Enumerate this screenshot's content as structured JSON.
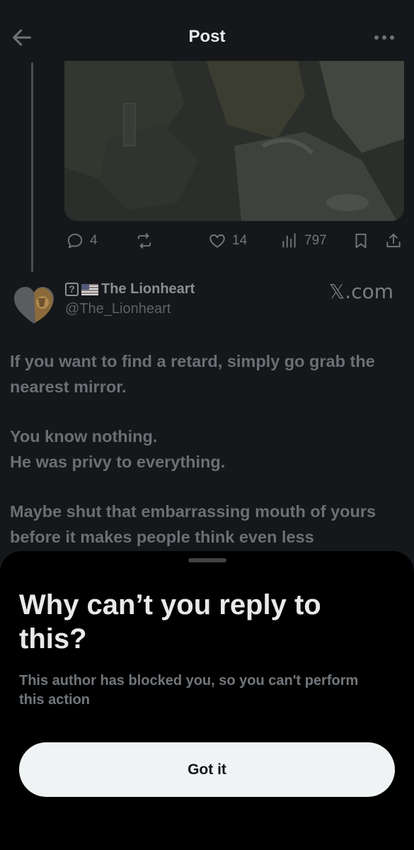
{
  "header": {
    "title": "Post",
    "back_icon": "back-arrow-icon",
    "more_icon": "more-dots-icon"
  },
  "actions": {
    "replies": "4",
    "retweets": "",
    "likes": "14",
    "views": "797"
  },
  "quoted": {
    "badge": "?",
    "name": "The Lionheart",
    "handle": "@The_Lionheart",
    "watermark": "𝕏.com"
  },
  "post": {
    "paragraph1": "If you want to find a retard, simply go grab the nearest mirror.",
    "paragraph2_line1": "You know nothing.",
    "paragraph2_line2": "He was privy to everything.",
    "paragraph3": "Maybe shut that embarrassing mouth of yours before it makes people think even less"
  },
  "sheet": {
    "title": "Why can’t you reply to this?",
    "description": "This author has blocked you, so you can't perform this action",
    "button_label": "Got it"
  },
  "colors": {
    "background": "#15171a",
    "sheet": "#000000",
    "button": "#eff3f4",
    "muted_text": "#71767b"
  }
}
